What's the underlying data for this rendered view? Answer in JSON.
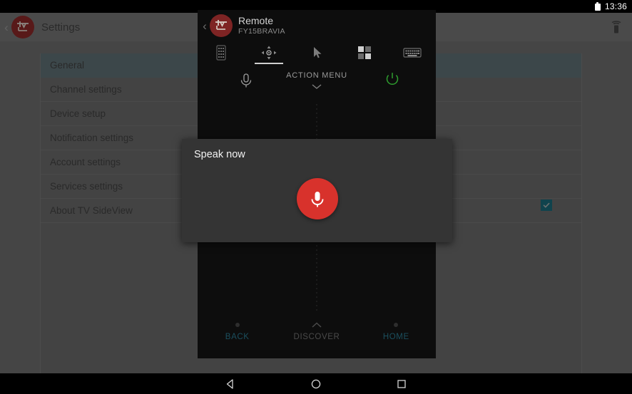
{
  "status_bar": {
    "time": "13:36",
    "battery_icon": "battery-icon"
  },
  "app": {
    "title": "Settings",
    "logo_icon": "tv-sideview-logo-icon",
    "back_icon": "chevron-left-icon",
    "device_icon": "device-remote-icon",
    "settings_items": [
      {
        "label": "General",
        "selected": true
      },
      {
        "label": "Channel settings",
        "selected": false
      },
      {
        "label": "Device setup",
        "selected": false
      },
      {
        "label": "Notification settings",
        "selected": false
      },
      {
        "label": "Account settings",
        "selected": false
      },
      {
        "label": "Services settings",
        "selected": false
      },
      {
        "label": "About TV SideView",
        "selected": false
      }
    ],
    "checkbox": {
      "name": "settings-checkbox",
      "checked": true,
      "color": "#17616f"
    }
  },
  "remote_panel": {
    "back_icon": "chevron-left-icon",
    "logo_icon": "tv-sideview-logo-icon",
    "title": "Remote",
    "device": "FY15BRAVIA",
    "tabs": [
      {
        "icon": "numeric-keypad-icon",
        "active": false
      },
      {
        "icon": "dpad-icon",
        "active": true
      },
      {
        "icon": "cursor-pointer-icon",
        "active": false
      },
      {
        "icon": "quad-tiles-icon",
        "active": false
      },
      {
        "icon": "keyboard-icon",
        "active": false
      }
    ],
    "mic_icon": "microphone-icon",
    "action_menu_label": "ACTION MENU",
    "action_menu_chevron": "chevron-down-icon",
    "power_icon": "power-icon",
    "power_color": "#2f9e2f",
    "bottom_buttons": [
      {
        "label": "BACK",
        "glyph": "dot-icon",
        "color": "#1b4f5e"
      },
      {
        "label": "DISCOVER",
        "glyph": "chevron-up-icon",
        "color": "#4a4a4a"
      },
      {
        "label": "HOME",
        "glyph": "dot-icon",
        "color": "#1b4f5e"
      }
    ]
  },
  "dialog": {
    "title": "Speak now",
    "mic_icon": "microphone-icon",
    "mic_button_color": "#d8322c"
  },
  "nav_bar": {
    "back_icon": "triangle-back-icon",
    "home_icon": "circle-home-icon",
    "recents_icon": "square-recents-icon"
  }
}
